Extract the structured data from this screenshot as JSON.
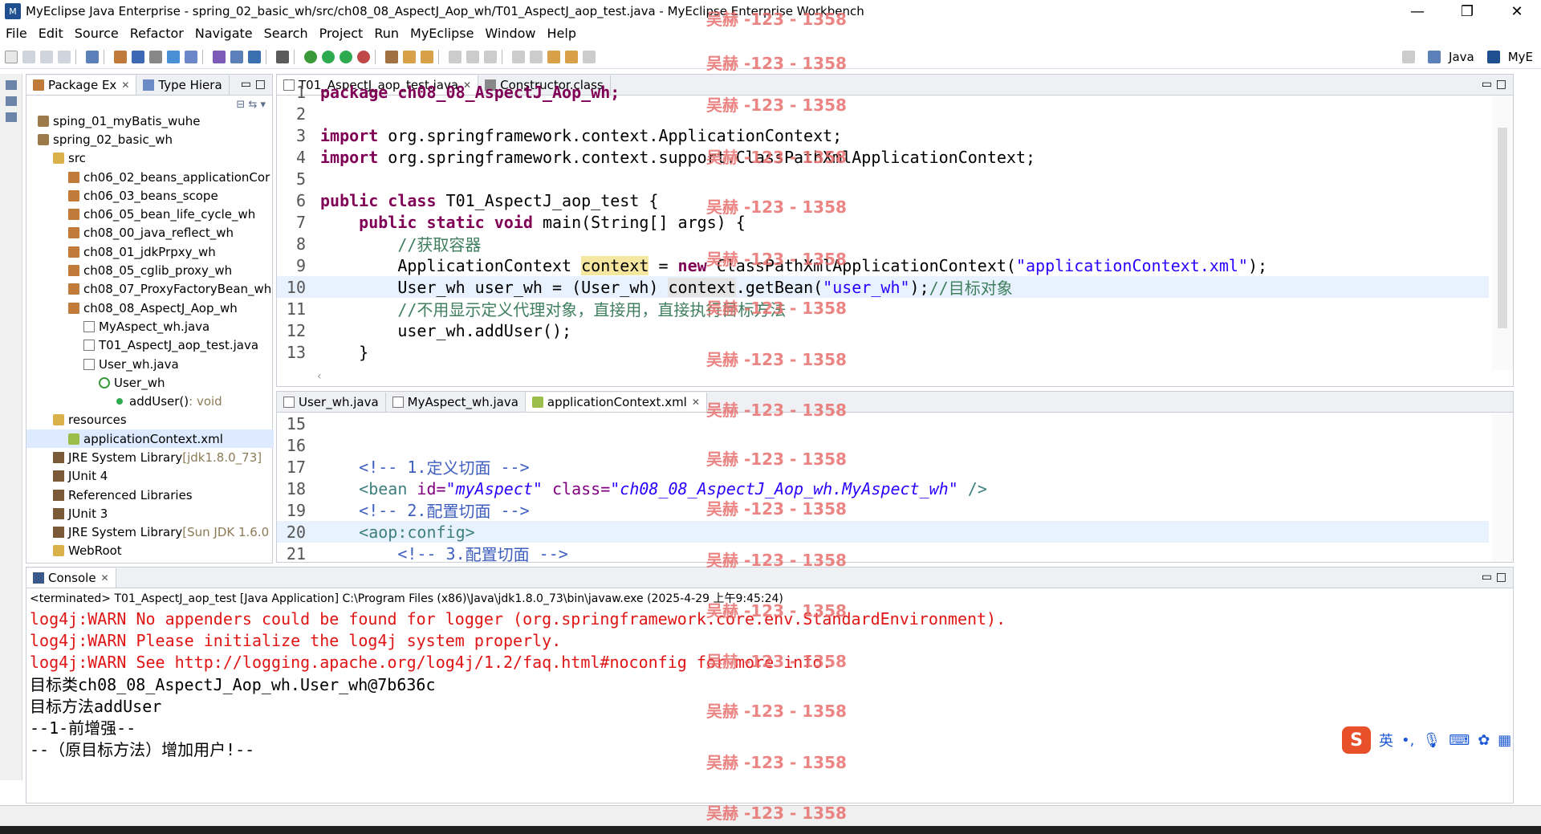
{
  "window": {
    "title": "MyEclipse Java Enterprise - spring_02_basic_wh/src/ch08_08_AspectJ_Aop_wh/T01_AspectJ_aop_test.java - MyEclipse Enterprise Workbench",
    "minimize": "—",
    "maximize": "❐",
    "close": "✕"
  },
  "menu": [
    "File",
    "Edit",
    "Source",
    "Refactor",
    "Navigate",
    "Search",
    "Project",
    "Run",
    "MyEclipse",
    "Window",
    "Help"
  ],
  "perspectives": {
    "java": "Java",
    "myeclipse": "MyE"
  },
  "package_explorer": {
    "tabs": [
      "Package Ex",
      "Type Hiera"
    ],
    "tree": [
      {
        "label": "sping_01_myBatis_wuhe",
        "icon": "project-icon",
        "indent": 0
      },
      {
        "label": "spring_02_basic_wh",
        "icon": "project-icon",
        "indent": 0
      },
      {
        "label": "src",
        "icon": "source-folder-icon",
        "indent": 1
      },
      {
        "label": "ch06_02_beans_applicationCor",
        "icon": "package-icon",
        "indent": 2
      },
      {
        "label": "ch06_03_beans_scope",
        "icon": "package-icon",
        "indent": 2
      },
      {
        "label": "ch06_05_bean_life_cycle_wh",
        "icon": "package-icon",
        "indent": 2
      },
      {
        "label": "ch08_00_java_reflect_wh",
        "icon": "package-icon",
        "indent": 2
      },
      {
        "label": "ch08_01_jdkPrpxy_wh",
        "icon": "package-icon",
        "indent": 2
      },
      {
        "label": "ch08_05_cglib_proxy_wh",
        "icon": "package-icon",
        "indent": 2
      },
      {
        "label": "ch08_07_ProxyFactoryBean_wh",
        "icon": "package-icon",
        "indent": 2
      },
      {
        "label": "ch08_08_AspectJ_Aop_wh",
        "icon": "package-icon",
        "indent": 2
      },
      {
        "label": "MyAspect_wh.java",
        "icon": "java-file-icon",
        "indent": 3
      },
      {
        "label": "T01_AspectJ_aop_test.java",
        "icon": "java-file-icon",
        "indent": 3
      },
      {
        "label": "User_wh.java",
        "icon": "java-file-icon",
        "indent": 3
      },
      {
        "label": "User_wh",
        "icon": "class-icon",
        "indent": 4
      },
      {
        "label": "addUser()",
        "suffix": " : void",
        "icon": "method-icon",
        "indent": 5
      },
      {
        "label": "resources",
        "icon": "source-folder-icon",
        "indent": 1
      },
      {
        "label": "applicationContext.xml",
        "icon": "xml-file-icon",
        "indent": 2,
        "selected": true
      },
      {
        "label": "JRE System Library",
        "suffix": " [jdk1.8.0_73]",
        "icon": "library-icon",
        "indent": 1
      },
      {
        "label": "JUnit 4",
        "icon": "library-icon",
        "indent": 1
      },
      {
        "label": "Referenced Libraries",
        "icon": "library-icon",
        "indent": 1
      },
      {
        "label": "JUnit 3",
        "icon": "library-icon",
        "indent": 1
      },
      {
        "label": "JRE System Library",
        "suffix": " [Sun JDK 1.6.0",
        "icon": "library-icon",
        "indent": 1
      },
      {
        "label": "WebRoot",
        "icon": "folder-icon",
        "indent": 1
      }
    ]
  },
  "editor_top": {
    "tabs": [
      "T01_AspectJ_aop_test.java",
      "Constructor.class"
    ],
    "line_numbers": [
      "1",
      "2",
      "3",
      "4",
      "5",
      "6",
      "7",
      "8",
      "9",
      "10",
      "11",
      "12",
      "13"
    ],
    "lines": {
      "l1": "package ch08_08_AspectJ_Aop_wh;",
      "l3a": "import",
      "l3b": " org.springframework.context.ApplicationContext;",
      "l4a": "import",
      "l4b": " org.springframework.context.support.ClassPathXmlApplicationContext;",
      "l6a": "public class",
      "l6b": " T01_AspectJ_aop_test {",
      "l7a": "    public static void",
      "l7b": " main(String[] args) {",
      "l8": "        //获取容器",
      "l9a": "        ApplicationContext ",
      "l9b": "context",
      "l9c": " = ",
      "l9d": "new",
      "l9e": " ClassPathXmlApplicationContext(",
      "l9f": "\"applicationContext.xml\"",
      "l9g": ");",
      "l10a": "        User_wh user_wh = (User_wh) ",
      "l10b": "context",
      "l10c": ".getBean(",
      "l10d": "\"user_wh\"",
      "l10e": ");",
      "l10f": "//目标对象",
      "l11": "        //不用显示定义代理对象，直接用，直接执行目标方法",
      "l12": "        user_wh.addUser();",
      "l13": "    }"
    }
  },
  "editor_bottom": {
    "tabs": [
      "User_wh.java",
      "MyAspect_wh.java",
      "applicationContext.xml"
    ],
    "line_numbers": [
      "15",
      "16",
      "17",
      "18",
      "19",
      "20",
      "21"
    ],
    "lines": {
      "l17a": "    <!-- 1.",
      "l17b": "定义切面",
      "l17c": " -->",
      "l18a": "    <bean ",
      "l18b": "id=",
      "l18c": "\"myAspect\"",
      "l18d": " class=",
      "l18e": "\"ch08_08_AspectJ_Aop_wh.MyAspect_wh\"",
      "l18f": " />",
      "l19a": "    <!-- 2.",
      "l19b": "配置切面",
      "l19c": " -->",
      "l20": "    <aop:config>",
      "l21a": "        <!-- 3.",
      "l21b": "配置切面",
      "l21c": " -->"
    }
  },
  "console": {
    "tab": "Console",
    "terminated": "<terminated> T01_AspectJ_aop_test [Java Application] C:\\Program Files (x86)\\Java\\jdk1.8.0_73\\bin\\javaw.exe (2025-4-29 上午9:45:24)",
    "output": [
      {
        "text": "log4j:WARN No appenders could be found for logger (org.springframework.core.env.StandardEnvironment).",
        "error": true
      },
      {
        "text": "log4j:WARN Please initialize the log4j system properly.",
        "error": true
      },
      {
        "text": "log4j:WARN See http://logging.apache.org/log4j/1.2/faq.html#noconfig for more info.",
        "error": true
      },
      {
        "text": "目标类ch08_08_AspectJ_Aop_wh.User_wh@7b636c",
        "error": false
      },
      {
        "text": "目标方法addUser",
        "error": false
      },
      {
        "text": "--1-前增强--",
        "error": false
      },
      {
        "text": "--（原目标方法）增加用户!--",
        "error": false
      }
    ]
  },
  "ime": {
    "logo": "S",
    "lang": "英"
  },
  "watermark": "吴赫 -123 - 1358",
  "colors": {
    "keyword": "#7f0055",
    "string": "#2a00ff",
    "comment": "#3f7f5f",
    "error": "#e01414",
    "watermark": "#e8706f"
  }
}
